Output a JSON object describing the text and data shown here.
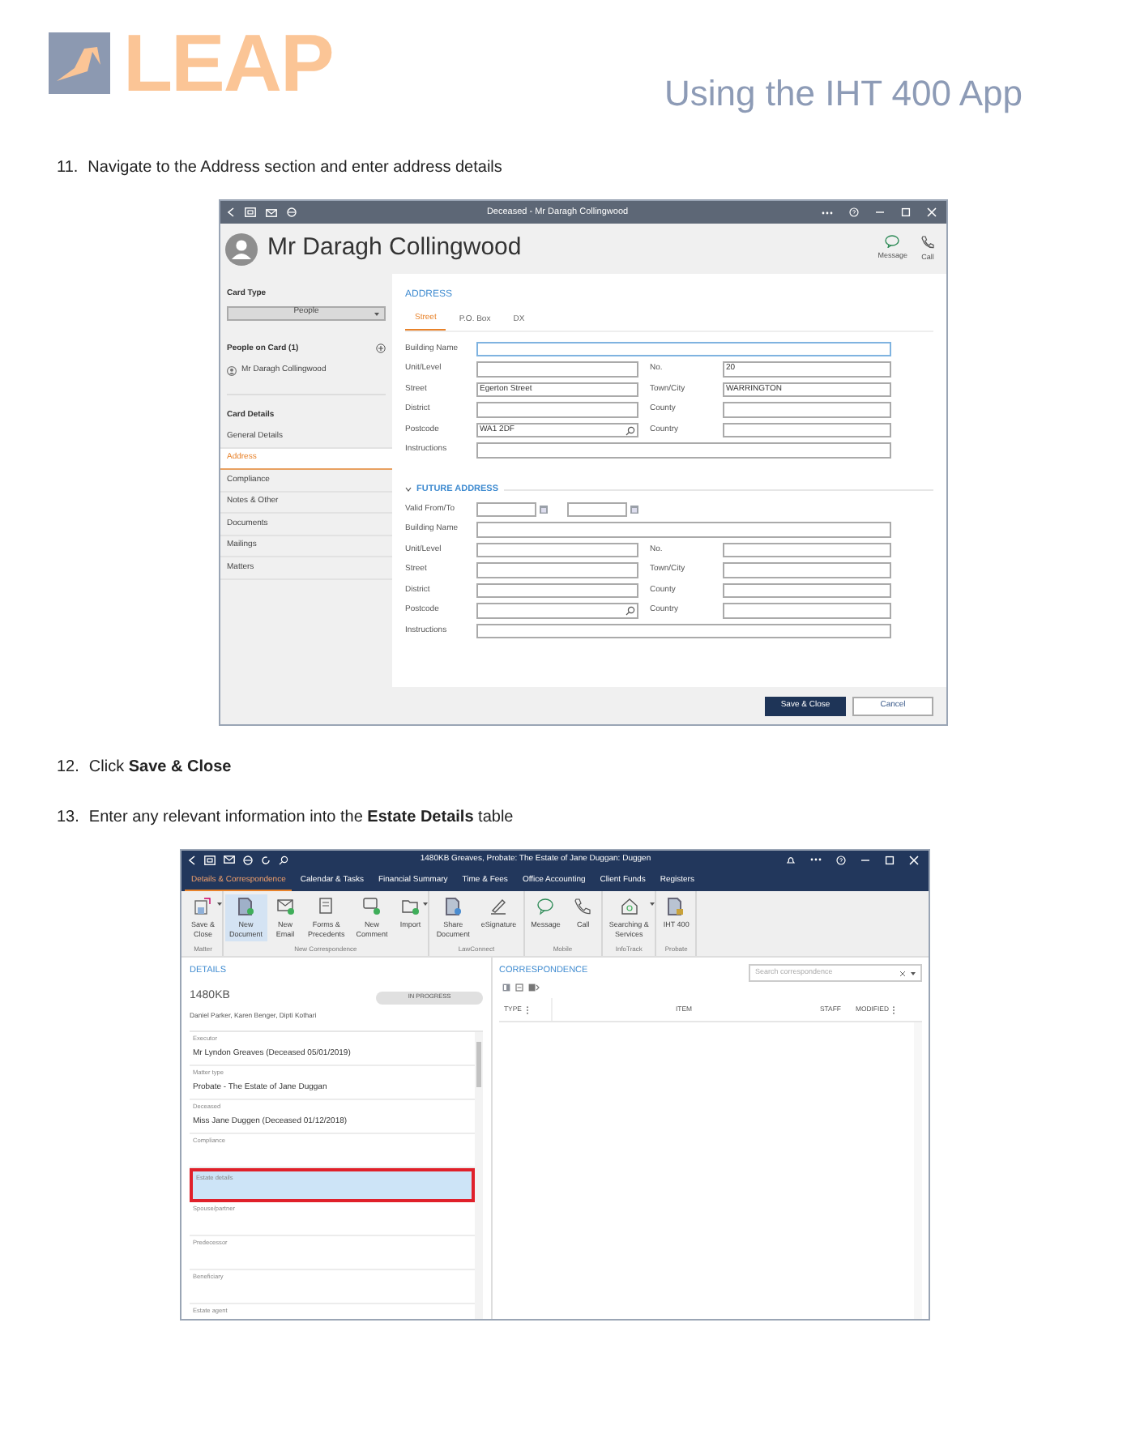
{
  "header": {
    "logo": "LEAP",
    "title": "Using the IHT 400 App"
  },
  "steps": [
    {
      "number": "11.",
      "text": "Navigate to the Address section and enter address details"
    },
    {
      "number": "12.",
      "text": "Click **Save & Close**"
    },
    {
      "number": "13.",
      "text": "Enter any relevant information into the **Estate Details** table"
    }
  ],
  "contact_window": {
    "title": "Deceased - Mr Daragh Collingwood",
    "contact_name": "Mr Daragh Collingwood",
    "header_actions": [
      "Message",
      "Call"
    ],
    "sidebar": {
      "card_type_label": "Card Type",
      "card_type_value": "People",
      "people_label": "People on Card (1)",
      "people": [
        "Mr Daragh Collingwood"
      ],
      "card_details_label": "Card Details",
      "items": [
        {
          "label": "General Details",
          "selected": false
        },
        {
          "label": "Address",
          "selected": true
        },
        {
          "label": "Compliance",
          "selected": false
        },
        {
          "label": "Notes & Other",
          "selected": false
        },
        {
          "label": "Documents",
          "selected": false
        },
        {
          "label": "Mailings",
          "selected": false
        },
        {
          "label": "Matters",
          "selected": false
        }
      ]
    },
    "address": {
      "heading": "ADDRESS",
      "tabs": [
        {
          "label": "Street",
          "selected": true
        },
        {
          "label": "P.O. Box",
          "selected": false
        },
        {
          "label": "DX",
          "selected": false
        }
      ],
      "rows": [
        [
          {
            "label": "Building Name"
          }
        ],
        [
          {
            "label": "Unit/Level"
          },
          {
            "label": "No.",
            "value": "20"
          }
        ],
        [
          {
            "label": "Street",
            "value": "Egerton Street"
          },
          {
            "label": "Town/City",
            "value": "WARRINGTON"
          }
        ],
        [
          {
            "label": "District"
          },
          {
            "label": "County"
          }
        ],
        [
          {
            "label": "Postcode",
            "value": "WA1 2DF",
            "kind": "search"
          },
          {
            "label": "Country"
          }
        ],
        [
          {
            "label": "Instructions"
          }
        ]
      ]
    },
    "future_address": {
      "heading": "FUTURE ADDRESS",
      "expanded": true,
      "valid_label": "Valid From/To",
      "rows": [
        [
          {
            "label": "Building Name"
          }
        ],
        [
          {
            "label": "Unit/Level"
          },
          {
            "label": "No."
          }
        ],
        [
          {
            "label": "Street"
          },
          {
            "label": "Town/City"
          }
        ],
        [
          {
            "label": "District"
          },
          {
            "label": "County"
          }
        ],
        [
          {
            "label": "Postcode",
            "kind": "search"
          },
          {
            "label": "Country"
          }
        ],
        [
          {
            "label": "Instructions"
          }
        ]
      ]
    },
    "buttons": [
      {
        "label": "Save & Close",
        "kind": "primary"
      },
      {
        "label": "Cancel",
        "kind": "secondary"
      }
    ]
  },
  "matter_window": {
    "title": "1480KB Greaves, Probate: The Estate of Jane Duggan: Duggen",
    "tabs": [
      {
        "label": "Details & Correspondence",
        "selected": true
      },
      {
        "label": "Calendar & Tasks",
        "selected": false
      },
      {
        "label": "Financial Summary",
        "selected": false
      },
      {
        "label": "Time & Fees",
        "selected": false
      },
      {
        "label": "Office Accounting",
        "selected": false
      },
      {
        "label": "Client Funds",
        "selected": false
      },
      {
        "label": "Registers",
        "selected": false
      }
    ],
    "ribbon": [
      {
        "name": "Matter",
        "buttons": [
          {
            "lines": [
              "Save &",
              "Close"
            ],
            "dropdown": true,
            "selected": false
          }
        ]
      },
      {
        "name": "New Correspondence",
        "buttons": [
          {
            "lines": [
              "New",
              "Document"
            ],
            "dropdown": false,
            "selected": true
          },
          {
            "lines": [
              "New",
              "Email"
            ],
            "dropdown": false,
            "selected": false
          },
          {
            "lines": [
              "Forms &",
              "Precedents"
            ],
            "dropdown": false,
            "selected": false
          },
          {
            "lines": [
              "New",
              "Comment"
            ],
            "dropdown": false,
            "selected": false
          },
          {
            "lines": [
              "Import"
            ],
            "dropdown": true,
            "selected": false
          }
        ]
      },
      {
        "name": "LawConnect",
        "buttons": [
          {
            "lines": [
              "Share",
              "Document"
            ],
            "dropdown": false,
            "selected": false
          },
          {
            "lines": [
              "eSignature"
            ],
            "dropdown": false,
            "selected": false
          }
        ]
      },
      {
        "name": "Mobile",
        "buttons": [
          {
            "lines": [
              "Message"
            ],
            "dropdown": false,
            "selected": false
          },
          {
            "lines": [
              "Call"
            ],
            "dropdown": false,
            "selected": false
          }
        ]
      },
      {
        "name": "InfoTrack",
        "buttons": [
          {
            "lines": [
              "Searching &",
              "Services"
            ],
            "dropdown": true,
            "selected": false
          }
        ]
      },
      {
        "name": "Probate",
        "buttons": [
          {
            "lines": [
              "IHT 400"
            ],
            "dropdown": false,
            "selected": false
          }
        ]
      }
    ],
    "details": {
      "heading": "DETAILS",
      "matter_number": "1480KB",
      "status": "IN PROGRESS",
      "staff": "Daniel Parker, Karen Benger, Dipti Kothari",
      "items": [
        {
          "label": "Executor",
          "value": "Mr Lyndon Greaves (Deceased 05/01/2019)",
          "highlighted": false
        },
        {
          "label": "Matter type",
          "value": "Probate - The Estate of Jane Duggan",
          "highlighted": false
        },
        {
          "label": "Deceased",
          "value": "Miss Jane Duggen (Deceased 01/12/2018)",
          "highlighted": false
        },
        {
          "label": "Compliance",
          "highlighted": false
        },
        {
          "label": "Estate details",
          "highlighted": true
        },
        {
          "label": "Spouse/partner",
          "highlighted": false
        },
        {
          "label": "Predecessor",
          "highlighted": false
        },
        {
          "label": "Beneficiary",
          "highlighted": false
        },
        {
          "label": "Estate agent",
          "highlighted": false
        }
      ]
    },
    "correspondence": {
      "heading": "CORRESPONDENCE",
      "search_placeholder": "Search correspondence",
      "columns": [
        "TYPE",
        "ITEM",
        "STAFF",
        "MODIFIED"
      ]
    }
  }
}
